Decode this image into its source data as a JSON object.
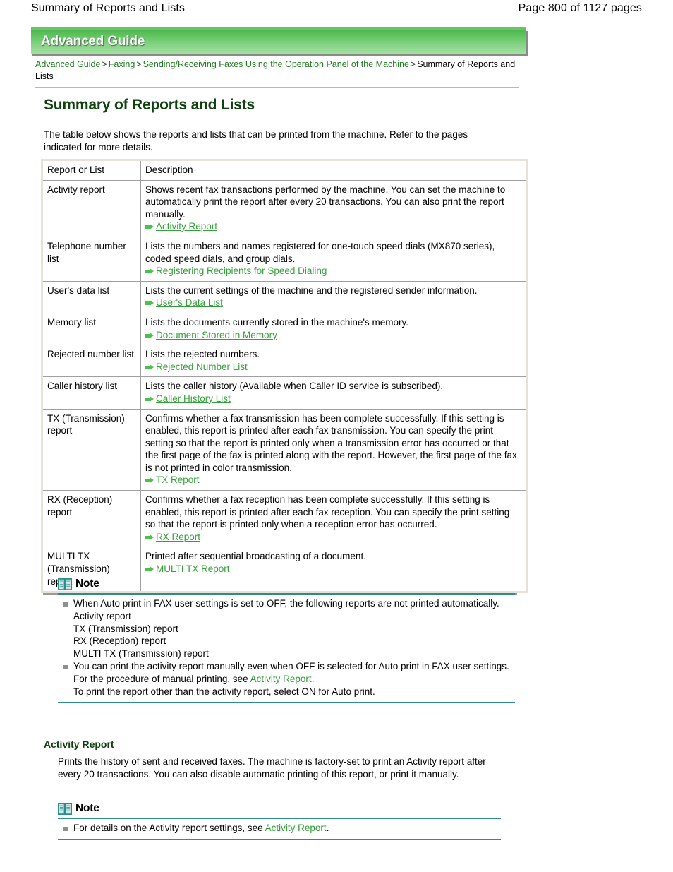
{
  "header": {
    "doc_title": "Summary of Reports and Lists",
    "page_count": "Page 800 of 1127 pages"
  },
  "banner": {
    "label": "Advanced Guide"
  },
  "breadcrumb": {
    "items": [
      {
        "label": "Advanced Guide",
        "link": true
      },
      {
        "label": "Faxing",
        "link": true
      },
      {
        "label": "Sending/Receiving Faxes Using the Operation Panel of the Machine",
        "link": true
      },
      {
        "label": "Summary of Reports and Lists",
        "link": false
      }
    ],
    "separator": ">"
  },
  "main": {
    "heading": "Summary of Reports and Lists",
    "intro": "The table below shows the reports and lists that can be printed from the machine. Refer to the pages indicated for more details."
  },
  "table": {
    "headers": [
      "Report or List",
      "Description"
    ],
    "rows": [
      {
        "name": "Activity report",
        "description": "Shows recent fax transactions performed by the machine. You can set the machine to automatically print the report after every 20 transactions. You can also print the report manually.",
        "link": "Activity Report"
      },
      {
        "name": "Telephone number list",
        "description": "Lists the numbers and names registered for one-touch speed dials (MX870 series), coded speed dials, and group dials.",
        "link": "Registering Recipients for Speed Dialing"
      },
      {
        "name": "User's data list",
        "description": "Lists the current settings of the machine and the registered sender information.",
        "link": "User's Data List"
      },
      {
        "name": "Memory list",
        "description": "Lists the documents currently stored in the machine's memory.",
        "link": "Document Stored in Memory"
      },
      {
        "name": "Rejected number list",
        "description": "Lists the rejected numbers.",
        "link": "Rejected Number List"
      },
      {
        "name": "Caller history list",
        "description": "Lists the caller history (Available when Caller ID service is subscribed).",
        "link": "Caller History List"
      },
      {
        "name": "TX (Transmission) report",
        "description": "Confirms whether a fax transmission has been complete successfully. If this setting is enabled, this report is printed after each fax transmission. You can specify the print setting so that the report is printed only when a transmission error has occurred or that the first page of the fax is printed along with the report. However, the first page of the fax is not printed in color transmission.",
        "link": "TX Report"
      },
      {
        "name": "RX (Reception) report",
        "description": "Confirms whether a fax reception has been complete successfully. If this setting is enabled, this report is printed after each fax reception. You can specify the print setting so that the report is printed only when a reception error has occurred.",
        "link": "RX Report"
      },
      {
        "name": "MULTI TX (Transmission) report",
        "description": "Printed after sequential broadcasting of a document.",
        "link": "MULTI TX Report"
      }
    ]
  },
  "note_main": {
    "title": "Note",
    "item1_text": "When Auto print in FAX user settings is set to OFF, the following reports are not printed automatically.",
    "item1_lines": [
      "Activity report",
      "TX (Transmission) report",
      "RX (Reception) report",
      "MULTI TX (Transmission) report"
    ],
    "item2_pre": "You can print the activity report manually even when OFF is selected for Auto print in FAX user settings. For the procedure of manual printing, see",
    "item2_link": "Activity Report",
    "item2_post": ".",
    "item2_line2": "To print the report other than the activity report, select ON for Auto print."
  },
  "subsection": {
    "heading": "Activity Report",
    "body": "Prints the history of sent and received faxes. The machine is factory-set to print an Activity report after every 20 transactions. You can also disable automatic printing of this report, or print it manually."
  },
  "note_sub": {
    "title": "Note",
    "item_pre": "For details on the Activity report settings, see",
    "item_link": "Activity Report",
    "item_post": "."
  },
  "colors": {
    "banner_green": "#63c762",
    "link_green": "#34a03a",
    "heading_green": "#10420f",
    "note_teal": "#2e8b8b",
    "table_border": "#e6e3d6"
  }
}
